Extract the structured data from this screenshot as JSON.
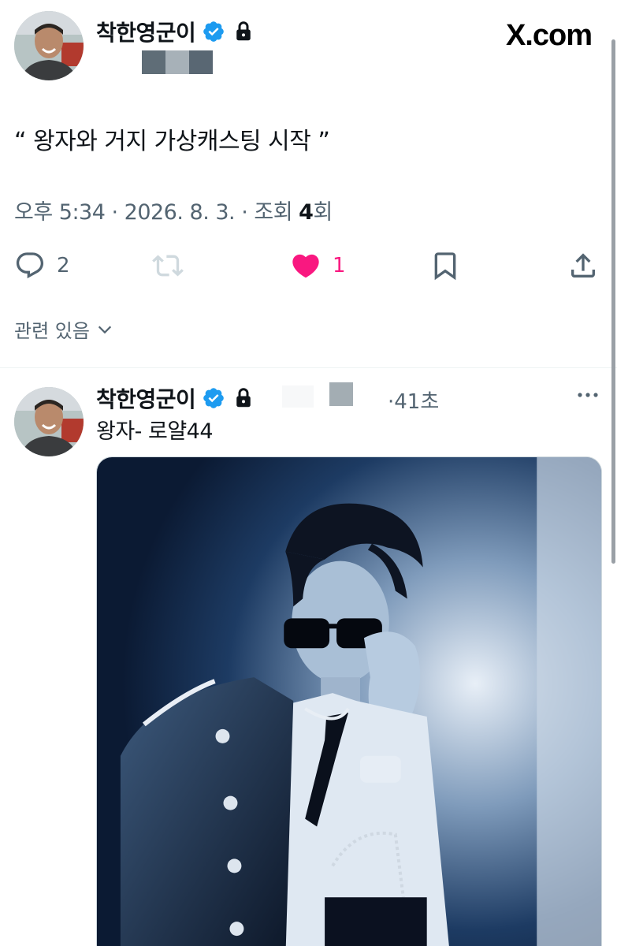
{
  "site": {
    "domain": "X.com"
  },
  "tweet": {
    "author": {
      "display_name": "착한영군이",
      "verified": true,
      "protected": true
    },
    "text": "“ 왕자와 거지 가상캐스팅 시작 ”",
    "meta": {
      "time_date": "오후 5:34 · 2026. 8. 3. · 조회 ",
      "views": "4",
      "views_suffix": "회"
    },
    "actions": {
      "reply_count": "2",
      "retweet_count": "",
      "like_count": "1",
      "liked": true
    },
    "related_label": "관련 있음"
  },
  "reply": {
    "author": {
      "display_name": "착한영군이",
      "verified": true,
      "protected": true
    },
    "time": "·41초",
    "text": "왕자- 로얄44"
  },
  "colors": {
    "verified": "#1d9bf0",
    "like": "#f91880",
    "secondary_text": "#536471",
    "primary_text": "#0f1419"
  },
  "icons": [
    "verified-badge-icon",
    "lock-icon",
    "reply-icon",
    "retweet-icon",
    "heart-icon",
    "bookmark-icon",
    "share-icon",
    "chevron-down-icon",
    "more-icon"
  ]
}
